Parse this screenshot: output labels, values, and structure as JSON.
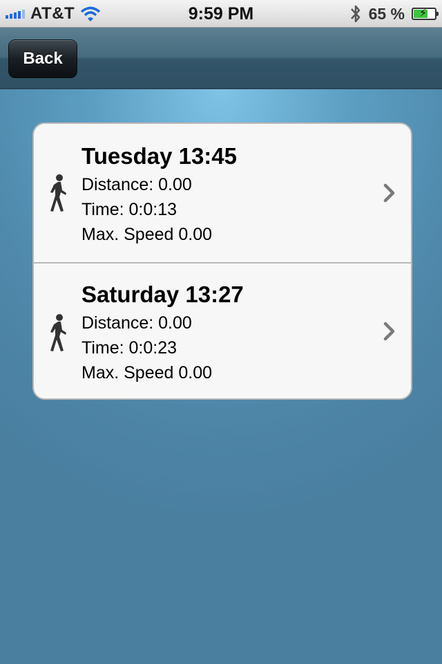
{
  "status_bar": {
    "carrier": "AT&T",
    "time": "9:59 PM",
    "battery_percent": "65 %",
    "battery_level": 0.65,
    "signal_icon": "signal-bars-icon",
    "wifi_icon": "wifi-icon",
    "bluetooth_icon": "bluetooth-icon",
    "battery_icon": "battery-charging-icon"
  },
  "navbar": {
    "back_label": "Back"
  },
  "runs": [
    {
      "title": "Tuesday 13:45",
      "distance": "Distance: 0.00",
      "time": "Time: 0:0:13",
      "max_speed": "Max. Speed 0.00",
      "icon": "walking-person-icon"
    },
    {
      "title": "Saturday 13:27",
      "distance": "Distance: 0.00",
      "time": "Time: 0:0:23",
      "max_speed": "Max. Speed 0.00",
      "icon": "walking-person-icon"
    }
  ],
  "colors": {
    "signal_blue": "#1e6bd8",
    "battery_green": "#3ec43e",
    "background_blue": "#4f86a8"
  }
}
